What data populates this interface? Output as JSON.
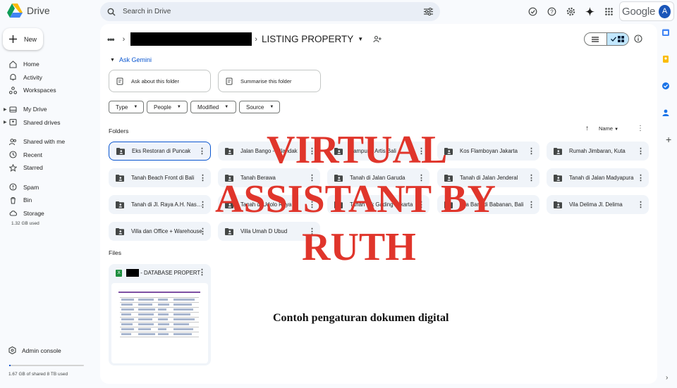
{
  "app": {
    "name": "Drive"
  },
  "search": {
    "placeholder": "Search in Drive"
  },
  "account": {
    "brand": "Google",
    "avatar_letter": "A"
  },
  "sidebar": {
    "new_label": "New",
    "items": [
      {
        "label": "Home",
        "icon": "home-icon"
      },
      {
        "label": "Activity",
        "icon": "bell-icon"
      },
      {
        "label": "Workspaces",
        "icon": "workspaces-icon"
      },
      {
        "label": "My Drive",
        "icon": "drive-icon"
      },
      {
        "label": "Shared drives",
        "icon": "shared-drives-icon"
      },
      {
        "label": "Shared with me",
        "icon": "people-icon"
      },
      {
        "label": "Recent",
        "icon": "clock-icon"
      },
      {
        "label": "Starred",
        "icon": "star-icon"
      },
      {
        "label": "Spam",
        "icon": "spam-icon"
      },
      {
        "label": "Bin",
        "icon": "trash-icon"
      },
      {
        "label": "Storage",
        "icon": "cloud-icon"
      }
    ],
    "storage_used": "1.32 GB used",
    "admin_label": "Admin console",
    "shared_storage": "1.67 GB of shared 8 TB used"
  },
  "breadcrumb": {
    "current": "LISTING PROPERTY"
  },
  "gemini": {
    "title": "Ask Gemini",
    "cards": [
      "Ask about this folder",
      "Summarise this folder"
    ]
  },
  "filters": [
    "Type",
    "People",
    "Modified",
    "Source"
  ],
  "folders_heading": "Folders",
  "sort_label": "Name",
  "folders": [
    "Eks Restoran di Puncak",
    "Jalan Bango - Cilandak",
    "Kampung Artis Bali",
    "Kos Flamboyan Jakarta",
    "Rumah Jimbaran, Kuta",
    "Tanah Beach Front di Bali",
    "Tanah Berawa",
    "Tanah di Jalan Garuda",
    "Tanah di Jalan Jenderal",
    "Tanah di Jalan Madyapura",
    "Tanah di Jl. Raya A.H. Nasution",
    "Tanah di Udolo Raya",
    "Tanah Pik Gading Jakarta",
    "Vila Baru di Babanan, Bali",
    "Vila Delima Jl. Delima",
    "Villa dan Office + Warehouse",
    "Villa Umah D Ubud"
  ],
  "files_heading": "Files",
  "file": {
    "name": "- DATABASE PROPERTY",
    "type_badge": "X"
  },
  "watermark": {
    "line1": "VIRTUAL",
    "line2": "ASSISTANT BY",
    "line3": "RUTH",
    "caption": "Contoh pengaturan dokumen digital",
    "color": "#e0352b"
  }
}
